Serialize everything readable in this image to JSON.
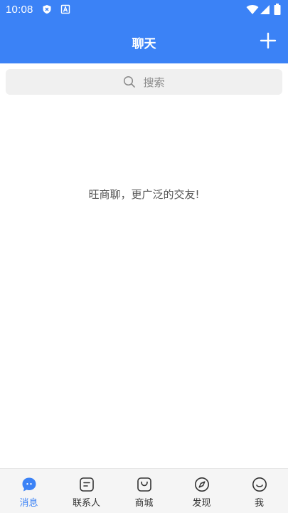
{
  "status_bar": {
    "time": "10:08",
    "notification_icons": [
      "shield-icon",
      "a-box-icon"
    ],
    "right_icons": [
      "wifi-icon",
      "signal-icon",
      "battery-icon"
    ]
  },
  "header": {
    "title": "聊天",
    "add_icon": "plus-icon"
  },
  "search": {
    "placeholder": "搜索"
  },
  "main": {
    "empty_message": "旺商聊，更广泛的交友!"
  },
  "tabbar": {
    "active_color": "#3b82f6",
    "items": [
      {
        "label": "消息",
        "icon": "chat-bubble-icon",
        "active": true
      },
      {
        "label": "联系人",
        "icon": "contacts-icon",
        "active": false
      },
      {
        "label": "商城",
        "icon": "shopping-bag-icon",
        "active": false
      },
      {
        "label": "发现",
        "icon": "compass-icon",
        "active": false
      },
      {
        "label": "我",
        "icon": "smiley-icon",
        "active": false
      }
    ]
  },
  "colors": {
    "brand": "#3b82f6",
    "search_bg": "#f0f0f0",
    "tabbar_bg": "#f5f5f5"
  }
}
